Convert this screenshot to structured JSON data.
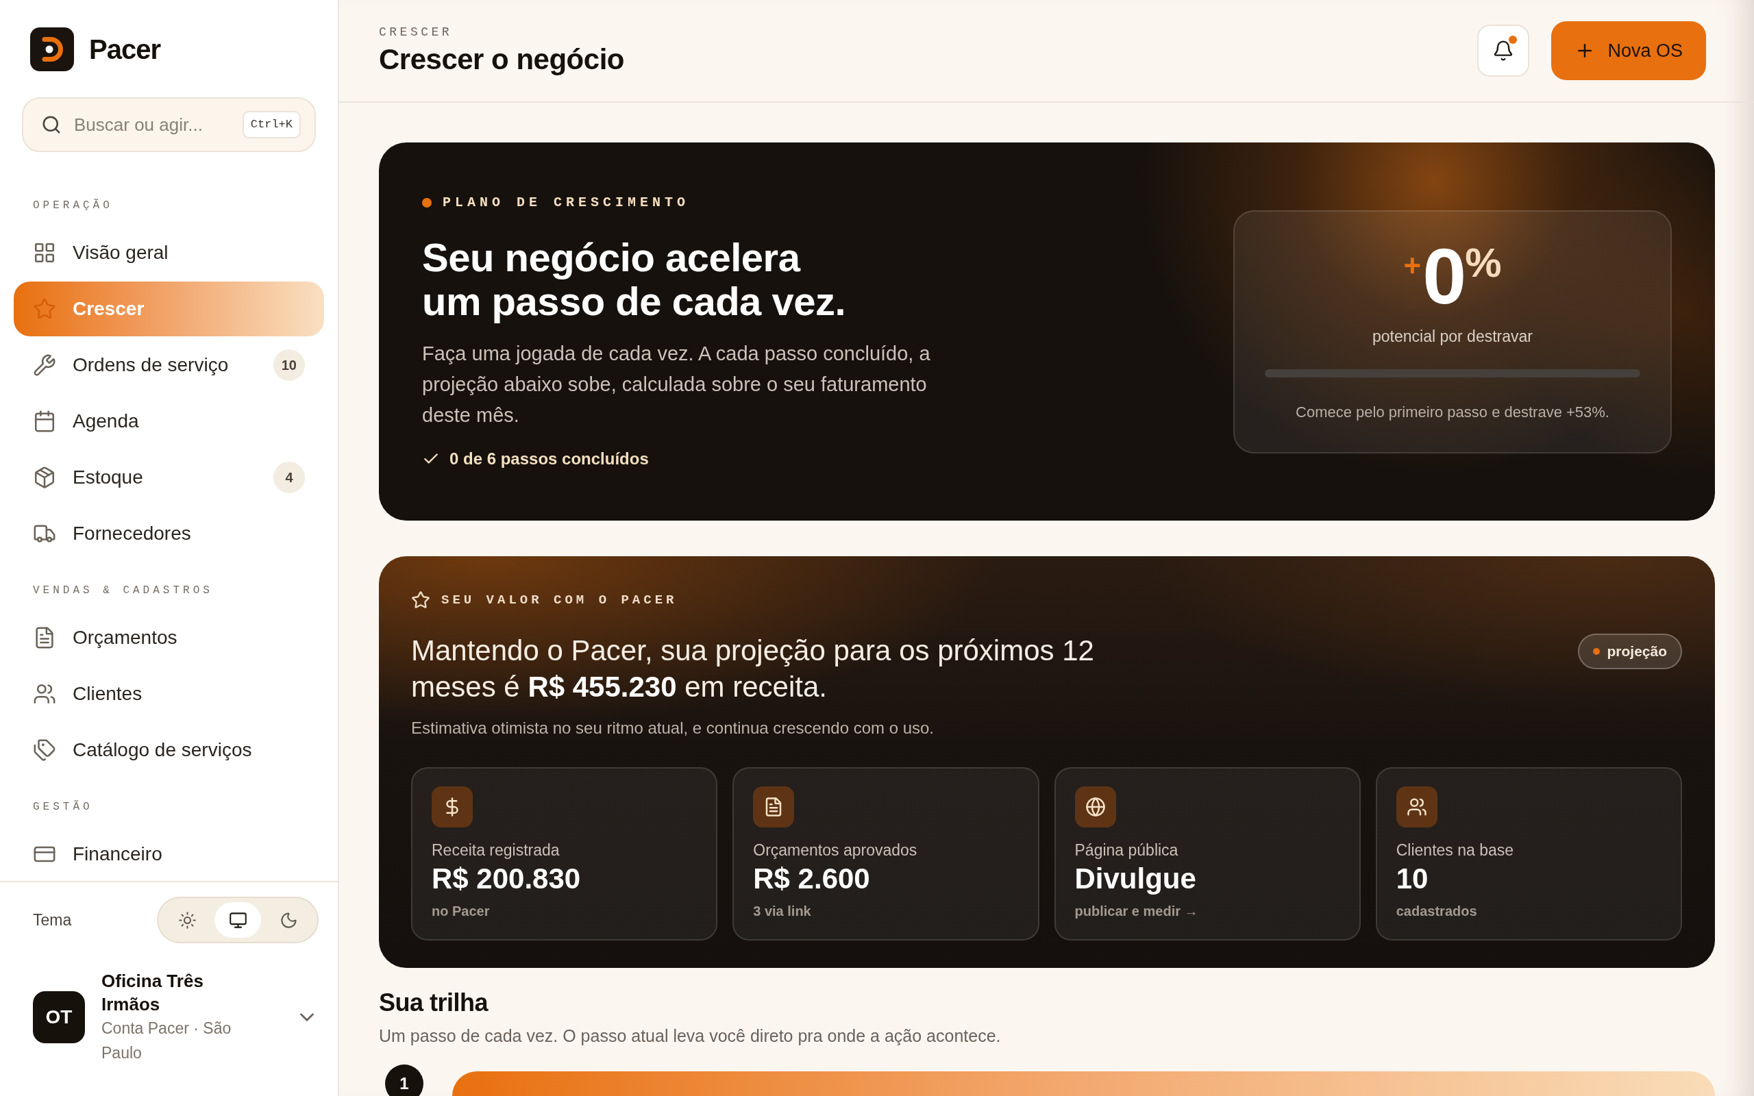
{
  "sidebar": {
    "brand": {
      "name": "Pacer"
    },
    "search": {
      "placeholder": "Buscar ou agir...",
      "shortcut": "Ctrl+K"
    },
    "sections": [
      {
        "title": "OPERAÇÃO",
        "items": [
          {
            "label": "Visão geral",
            "selected": false
          },
          {
            "label": "Crescer",
            "selected": true
          },
          {
            "label": "Ordens de serviço",
            "selected": false,
            "badge": "10"
          },
          {
            "label": "Agenda",
            "selected": false
          },
          {
            "label": "Estoque",
            "selected": false,
            "badge": "4"
          },
          {
            "label": "Fornecedores",
            "selected": false
          }
        ]
      },
      {
        "title": "VENDAS & CADASTROS",
        "items": [
          {
            "label": "Orçamentos",
            "selected": false
          },
          {
            "label": "Clientes",
            "selected": false
          },
          {
            "label": "Catálogo de serviços",
            "selected": false
          }
        ]
      },
      {
        "title": "GESTÃO",
        "items": [
          {
            "label": "Financeiro",
            "selected": false
          }
        ]
      }
    ],
    "theme": {
      "label": "Tema",
      "options": [
        {
          "selected": false
        },
        {
          "selected": true
        },
        {
          "selected": false
        }
      ]
    },
    "account": {
      "initials": "OT",
      "name": "Oficina Três Irmãos",
      "subtitle": "Conta Pacer · São Paulo"
    }
  },
  "header": {
    "eyebrow": "CRESCER",
    "title": "Crescer o negócio",
    "notifications": {
      "unread": true
    },
    "primary_action": "Nova OS"
  },
  "hero": {
    "eyebrow": "PLANO DE CRESCIMENTO",
    "title": "Seu negócio acelera um passo de cada vez.",
    "description": "Faça uma jogada de cada vez. A cada passo concluído, a projeção abaixo sobe, calculada sobre o seu faturamento deste mês.",
    "progress": {
      "text": "0 de 6 passos concluídos",
      "checked": true
    },
    "potential": {
      "value": "$^{+}$0$^{%}$",
      "label": "potencial por destravar",
      "level": 0,
      "hint": "Comece pelo primeiro passo e destrave +53%."
    }
  },
  "value": {
    "eyebrow": "SEU VALOR COM O PACER",
    "title": "Mantendo o Pacer, sua projeção para os próximos 12 meses é **R$ 455.230** em receita.",
    "tag": "projeção",
    "subtitle": "Estimativa otimista no seu ritmo atual, e continua crescendo com o uso.",
    "stats": [
      {
        "label": "Receita registrada",
        "value": "R$ 200.830",
        "note": "no Pacer"
      },
      {
        "label": "Orçamentos aprovados",
        "value": "R$ 2.600",
        "note": "3 via link"
      },
      {
        "label": "Página pública",
        "value": "Divulgue",
        "note": "publicar e medir →"
      },
      {
        "label": "Clientes na base",
        "value": "10",
        "note": "cadastrados"
      }
    ]
  },
  "trail": {
    "title": "Sua trilha",
    "description": "Um passo de cada vez. O passo atual leva você direto pra onde a ação acontece.",
    "steps": [
      {
        "number": "1",
        "current": true
      }
    ]
  }
}
